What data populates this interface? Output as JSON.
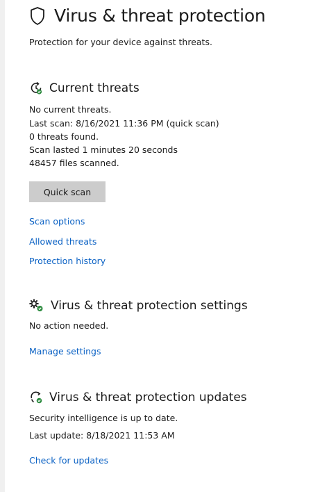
{
  "header": {
    "title": "Virus & threat protection",
    "subtitle": "Protection for your device against threats.",
    "icon": "shield-icon"
  },
  "current_threats": {
    "title": "Current threats",
    "icon": "clock-refresh-icon",
    "lines": [
      "No current threats.",
      "Last scan: 8/16/2021 11:36 PM (quick scan)",
      "0 threats found.",
      "Scan lasted 1 minutes 20 seconds",
      "48457 files scanned."
    ],
    "quick_scan_label": "Quick scan",
    "links": [
      "Scan options",
      "Allowed threats",
      "Protection history"
    ]
  },
  "settings": {
    "title": "Virus & threat protection settings",
    "icon": "gear-check-icon",
    "status": "No action needed.",
    "link": "Manage settings"
  },
  "updates": {
    "title": "Virus & threat protection updates",
    "icon": "sync-check-icon",
    "lines": [
      "Security intelligence is up to date.",
      "Last update: 8/18/2021 11:53 AM"
    ],
    "link": "Check for updates"
  },
  "colors": {
    "link": "#0a61c4",
    "button": "#cccccc",
    "check_green": "#2b8a3e",
    "text": "#1b1b1b"
  }
}
